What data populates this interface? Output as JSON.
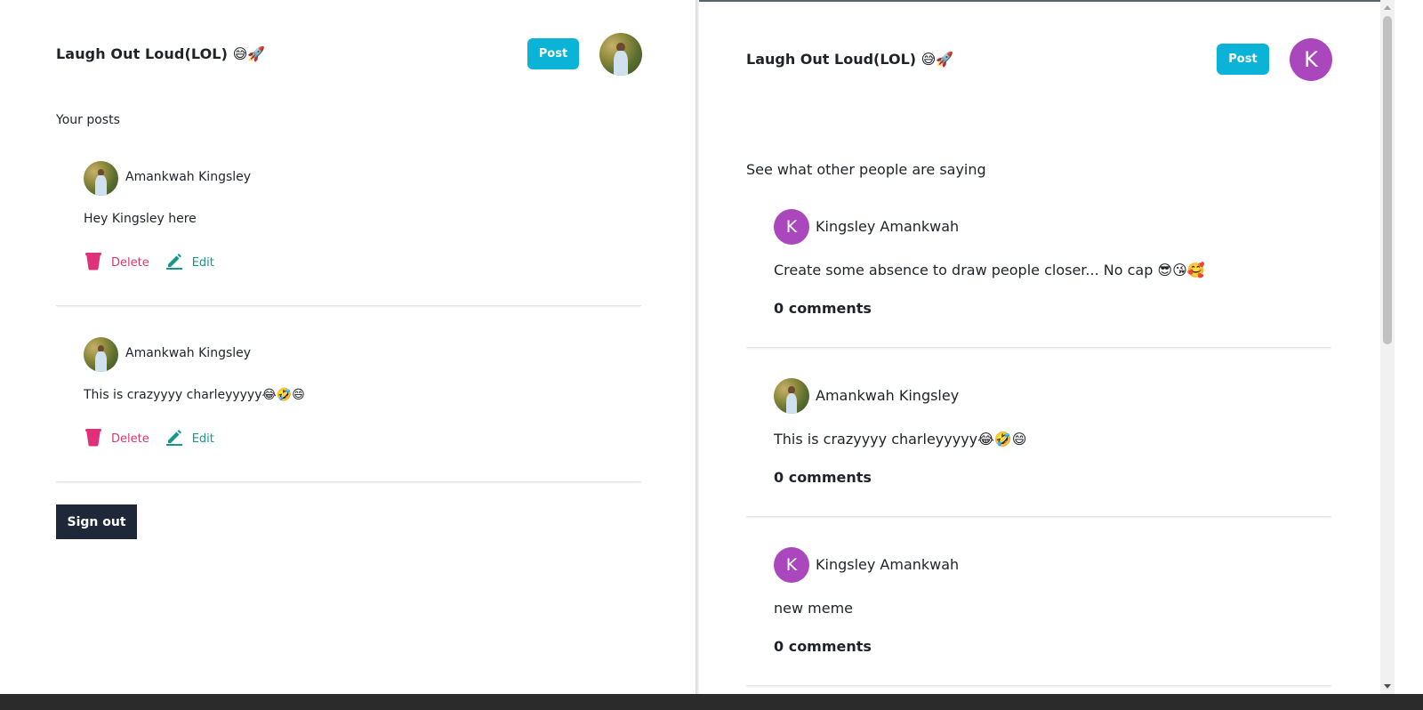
{
  "left": {
    "brand": "Laugh Out Loud(LOL) 😅🚀",
    "post_button": "Post",
    "section_title": "Your posts",
    "posts": [
      {
        "author": "Amankwah Kingsley",
        "text": "Hey Kingsley here",
        "delete_label": "Delete",
        "edit_label": "Edit"
      },
      {
        "author": "Amankwah Kingsley",
        "text": "This is crazyyyy charleyyyyy😂🤣😄",
        "delete_label": "Delete",
        "edit_label": "Edit"
      }
    ],
    "sign_out": "Sign out"
  },
  "right": {
    "brand": "Laugh Out Loud(LOL) 😅🚀",
    "post_button": "Post",
    "avatar_letter": "K",
    "section_title": "See what other people are saying",
    "feed": [
      {
        "author": "Kingsley Amankwah",
        "avatar_letter": "K",
        "avatar_type": "letter",
        "text": "Create some absence to draw people closer... No cap 😎😘🥰",
        "comments": "0 comments"
      },
      {
        "author": "Amankwah Kingsley",
        "avatar_type": "photo",
        "text": "This is crazyyyy charleyyyyy😂🤣😄",
        "comments": "0 comments"
      },
      {
        "author": "Kingsley Amankwah",
        "avatar_letter": "K",
        "avatar_type": "letter",
        "text": "new meme",
        "comments": "0 comments"
      }
    ]
  },
  "colors": {
    "post_button": "#0bb3d6",
    "avatar_purple": "#ab47bc",
    "delete": "#d63a6e",
    "edit": "#15978b",
    "sign_out_bg": "#1e2839"
  },
  "icons": {
    "delete": "trash-icon",
    "edit": "pencil-icon"
  }
}
